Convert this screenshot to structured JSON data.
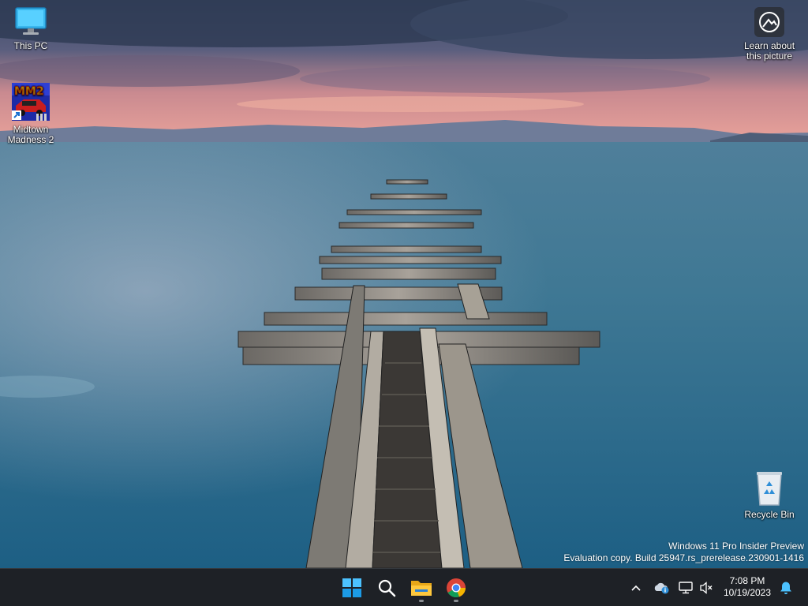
{
  "desktop": {
    "icons": {
      "this_pc": {
        "label": "This PC",
        "icon": "monitor-icon"
      },
      "midtown_madness": {
        "label": "Midtown Madness 2",
        "icon": "mm2-game-icon",
        "logo_text": "MM2"
      },
      "learn_picture": {
        "label": "Learn about this picture",
        "icon": "spotlight-camera-icon"
      },
      "recycle_bin": {
        "label": "Recycle Bin",
        "icon": "recycle-bin-icon"
      }
    },
    "watermark": {
      "line1": "Windows 11 Pro Insider Preview",
      "line2": "Evaluation copy. Build 25947.rs_prerelease.230901-1416"
    }
  },
  "taskbar": {
    "pinned": [
      {
        "name": "start-button",
        "icon": "windows-logo-icon"
      },
      {
        "name": "search-button",
        "icon": "search-icon"
      },
      {
        "name": "file-explorer-button",
        "icon": "folder-icon",
        "running": true
      },
      {
        "name": "chrome-button",
        "icon": "chrome-icon",
        "running": true
      }
    ],
    "tray": {
      "chevron_icon": "chevron-up-icon",
      "onedrive_icon": "onedrive-cloud-icon",
      "network_icon": "network-icon",
      "volume_icon": "volume-muted-icon",
      "time": "7:08 PM",
      "date": "10/19/2023",
      "notification_icon": "bell-icon"
    }
  },
  "colors": {
    "taskbar_bg": "#1e2126",
    "accent_blue": "#0a84d6",
    "sea": "#2f6d8e"
  }
}
